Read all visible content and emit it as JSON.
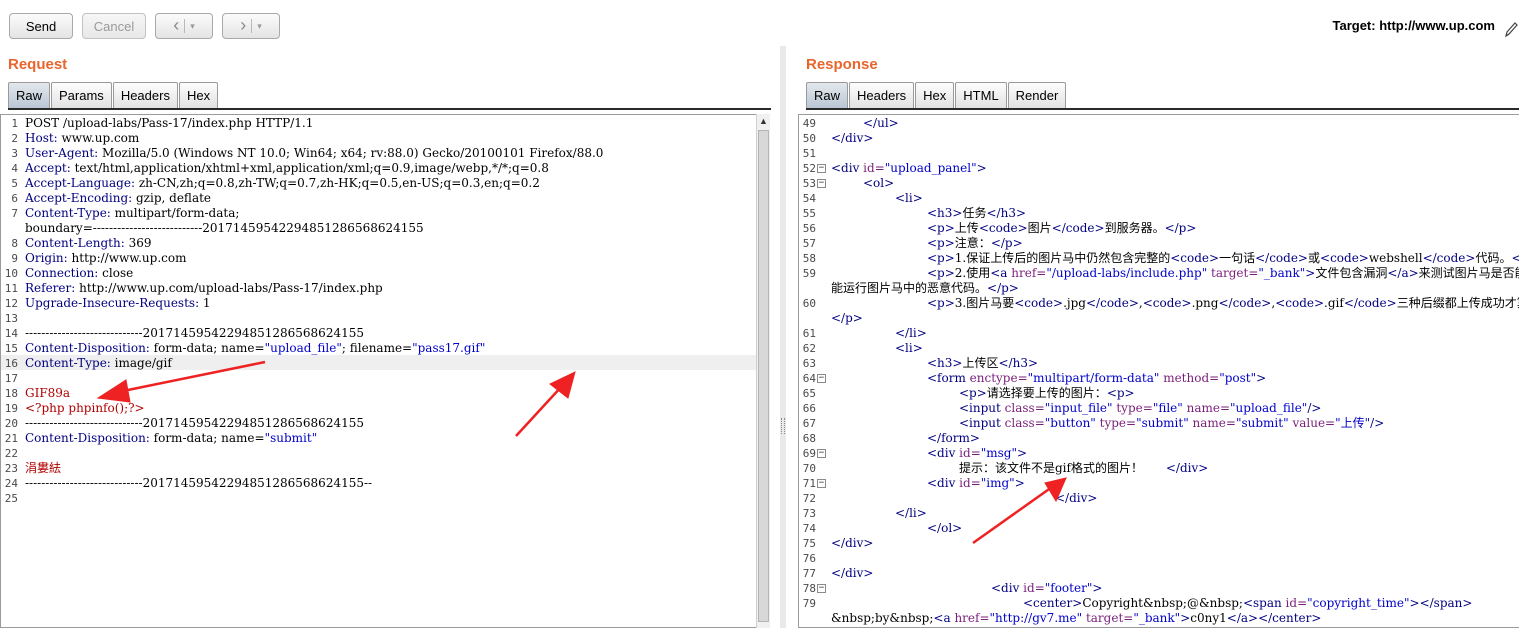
{
  "toolbar": {
    "send_label": "Send",
    "cancel_label": "Cancel",
    "back_icon": "‹",
    "forward_icon": "›",
    "dropdown_icon": "▾",
    "target_text": "Target: http://www.up.com",
    "edit_icon": "pencil-icon"
  },
  "request": {
    "title": "Request",
    "tabs": [
      "Raw",
      "Params",
      "Headers",
      "Hex"
    ],
    "active_tab": "Raw"
  },
  "response": {
    "title": "Response",
    "tabs": [
      "Raw",
      "Headers",
      "Hex",
      "HTML",
      "Render"
    ],
    "active_tab": "Raw"
  },
  "colors": {
    "title": "#e8662e",
    "header_key": "#000080",
    "string": "#0000c8",
    "annotation_arrow": "#ee2222"
  },
  "request_lines": [
    {
      "n": "1",
      "parts": [
        {
          "c": "v",
          "t": "POST /upload-labs/Pass-17/index.php HTTP/1.1"
        }
      ]
    },
    {
      "n": "2",
      "parts": [
        {
          "c": "k",
          "t": "Host: "
        },
        {
          "c": "v",
          "t": "www.up.com"
        }
      ]
    },
    {
      "n": "3",
      "parts": [
        {
          "c": "k",
          "t": "User-Agent: "
        },
        {
          "c": "v",
          "t": "Mozilla/5.0 (Windows NT 10.0; Win64; x64; rv:88.0) Gecko/20100101 Firefox/88.0"
        }
      ]
    },
    {
      "n": "4",
      "parts": [
        {
          "c": "k",
          "t": "Accept: "
        },
        {
          "c": "v",
          "t": "text/html,application/xhtml+xml,application/xml;q=0.9,image/webp,*/*;q=0.8"
        }
      ]
    },
    {
      "n": "5",
      "parts": [
        {
          "c": "k",
          "t": "Accept-Language: "
        },
        {
          "c": "v",
          "t": "zh-CN,zh;q=0.8,zh-TW;q=0.7,zh-HK;q=0.5,en-US;q=0.3,en;q=0.2"
        }
      ]
    },
    {
      "n": "6",
      "parts": [
        {
          "c": "k",
          "t": "Accept-Encoding: "
        },
        {
          "c": "v",
          "t": "gzip, deflate"
        }
      ]
    },
    {
      "n": "7",
      "parts": [
        {
          "c": "k",
          "t": "Content-Type: "
        },
        {
          "c": "v",
          "t": "multipart/form-data;"
        }
      ]
    },
    {
      "n": "",
      "parts": [
        {
          "c": "v",
          "t": "boundary=---------------------------201714595422948512865686241​55"
        }
      ]
    },
    {
      "n": "8",
      "parts": [
        {
          "c": "k",
          "t": "Content-Length: "
        },
        {
          "c": "v",
          "t": "369"
        }
      ]
    },
    {
      "n": "9",
      "parts": [
        {
          "c": "k",
          "t": "Origin: "
        },
        {
          "c": "v",
          "t": "http://www.up.com"
        }
      ]
    },
    {
      "n": "10",
      "parts": [
        {
          "c": "k",
          "t": "Connection: "
        },
        {
          "c": "v",
          "t": "close"
        }
      ]
    },
    {
      "n": "11",
      "parts": [
        {
          "c": "k",
          "t": "Referer: "
        },
        {
          "c": "v",
          "t": "http://www.up.com/upload-labs/Pass-17/index.php"
        }
      ]
    },
    {
      "n": "12",
      "parts": [
        {
          "c": "k",
          "t": "Upgrade-Insecure-Requests: "
        },
        {
          "c": "v",
          "t": "1"
        }
      ]
    },
    {
      "n": "13",
      "parts": []
    },
    {
      "n": "14",
      "parts": [
        {
          "c": "v",
          "t": "-----------------------------20171459542294851286568624155"
        }
      ]
    },
    {
      "n": "15",
      "parts": [
        {
          "c": "k",
          "t": "Content-Disposition: "
        },
        {
          "c": "v",
          "t": "form-data; name="
        },
        {
          "c": "str",
          "t": "\"upload_file\""
        },
        {
          "c": "v",
          "t": "; filename="
        },
        {
          "c": "str",
          "t": "\"pass17.gif\""
        }
      ]
    },
    {
      "n": "16",
      "parts": [
        {
          "c": "k",
          "t": "Content-Type: "
        },
        {
          "c": "v",
          "t": "image/gif"
        }
      ]
    },
    {
      "n": "17",
      "parts": []
    },
    {
      "n": "18",
      "parts": [
        {
          "c": "r",
          "t": "GIF89a"
        }
      ]
    },
    {
      "n": "19",
      "parts": [
        {
          "c": "r",
          "t": "<?php phpinfo();?>"
        }
      ]
    },
    {
      "n": "20",
      "parts": [
        {
          "c": "v",
          "t": "-----------------------------20171459542294851286568624155"
        }
      ]
    },
    {
      "n": "21",
      "parts": [
        {
          "c": "k",
          "t": "Content-Disposition: "
        },
        {
          "c": "v",
          "t": "form-data; name="
        },
        {
          "c": "str",
          "t": "\"submit\""
        }
      ]
    },
    {
      "n": "22",
      "parts": []
    },
    {
      "n": "23",
      "parts": [
        {
          "c": "r",
          "t": "涓婁紶"
        }
      ]
    },
    {
      "n": "24",
      "parts": [
        {
          "c": "v",
          "t": "-----------------------------20171459542294851286568624155--"
        }
      ]
    },
    {
      "n": "25",
      "parts": []
    }
  ],
  "response_lines": [
    {
      "n": "49",
      "f": "",
      "ind": 1,
      "parts": [
        {
          "c": "tag",
          "t": "</ul>"
        }
      ]
    },
    {
      "n": "50",
      "f": "",
      "ind": 0,
      "parts": [
        {
          "c": "tag",
          "t": "</div>"
        }
      ]
    },
    {
      "n": "51",
      "f": "",
      "ind": 0,
      "parts": []
    },
    {
      "n": "52",
      "f": "−",
      "ind": 0,
      "parts": [
        {
          "c": "tag",
          "t": "<div "
        },
        {
          "c": "attr",
          "t": "id="
        },
        {
          "c": "str",
          "t": "\"upload_panel\""
        },
        {
          "c": "tag",
          "t": ">"
        }
      ]
    },
    {
      "n": "53",
      "f": "−",
      "ind": 1,
      "parts": [
        {
          "c": "tag",
          "t": "<ol>"
        }
      ]
    },
    {
      "n": "54",
      "f": "",
      "ind": 2,
      "parts": [
        {
          "c": "tag",
          "t": "<li>"
        }
      ]
    },
    {
      "n": "55",
      "f": "",
      "ind": 3,
      "parts": [
        {
          "c": "tag",
          "t": "<h3>"
        },
        {
          "c": "tx",
          "t": "任务"
        },
        {
          "c": "tag",
          "t": "</h3>"
        }
      ]
    },
    {
      "n": "56",
      "f": "",
      "ind": 3,
      "parts": [
        {
          "c": "tag",
          "t": "<p>"
        },
        {
          "c": "tx",
          "t": "上传"
        },
        {
          "c": "tag",
          "t": "<code>"
        },
        {
          "c": "tx",
          "t": "图片"
        },
        {
          "c": "tag",
          "t": "</code>"
        },
        {
          "c": "tx",
          "t": "到服务器。"
        },
        {
          "c": "tag",
          "t": "</p>"
        }
      ]
    },
    {
      "n": "57",
      "f": "",
      "ind": 3,
      "parts": [
        {
          "c": "tag",
          "t": "<p>"
        },
        {
          "c": "tx",
          "t": "注意："
        },
        {
          "c": "tag",
          "t": "</p>"
        }
      ]
    },
    {
      "n": "58",
      "f": "",
      "ind": 3,
      "parts": [
        {
          "c": "tag",
          "t": "<p>"
        },
        {
          "c": "tx",
          "t": "1.保证上传后的图片马中仍然包含完整的"
        },
        {
          "c": "tag",
          "t": "<code>"
        },
        {
          "c": "tx",
          "t": "一句话"
        },
        {
          "c": "tag",
          "t": "</code>"
        },
        {
          "c": "tx",
          "t": "或"
        },
        {
          "c": "tag",
          "t": "<code>"
        },
        {
          "c": "tx",
          "t": "webshell"
        },
        {
          "c": "tag",
          "t": "</code>"
        },
        {
          "c": "tx",
          "t": "代码。"
        },
        {
          "c": "tag",
          "t": "</p>"
        }
      ]
    },
    {
      "n": "59",
      "f": "",
      "ind": 3,
      "parts": [
        {
          "c": "tag",
          "t": "<p>"
        },
        {
          "c": "tx",
          "t": "2.使用"
        },
        {
          "c": "tag",
          "t": "<a "
        },
        {
          "c": "attr",
          "t": "href="
        },
        {
          "c": "str",
          "t": "\"/upload-labs/include.php\""
        },
        {
          "c": "attr",
          "t": " target="
        },
        {
          "c": "str",
          "t": "\"_bank\""
        },
        {
          "c": "tag",
          "t": ">"
        },
        {
          "c": "tx",
          "t": "文件包含漏洞"
        },
        {
          "c": "tag",
          "t": "</a>"
        },
        {
          "c": "tx",
          "t": "来测试图片马是否能"
        }
      ]
    },
    {
      "n": "",
      "f": "",
      "ind": 0,
      "parts": [
        {
          "c": "tx",
          "t": "能运行图片马中的恶意代码。"
        },
        {
          "c": "tag",
          "t": "</p>"
        }
      ]
    },
    {
      "n": "60",
      "f": "",
      "ind": 3,
      "parts": [
        {
          "c": "tag",
          "t": "<p>"
        },
        {
          "c": "tx",
          "t": "3.图片马要"
        },
        {
          "c": "tag",
          "t": "<code>"
        },
        {
          "c": "tx",
          "t": ".jpg"
        },
        {
          "c": "tag",
          "t": "</code>"
        },
        {
          "c": "tx",
          "t": ","
        },
        {
          "c": "tag",
          "t": "<code>"
        },
        {
          "c": "tx",
          "t": ".png"
        },
        {
          "c": "tag",
          "t": "</code>"
        },
        {
          "c": "tx",
          "t": ","
        },
        {
          "c": "tag",
          "t": "<code>"
        },
        {
          "c": "tx",
          "t": ".gif"
        },
        {
          "c": "tag",
          "t": "</code>"
        },
        {
          "c": "tx",
          "t": "三种后缀都上传成功才算过关！"
        }
      ]
    },
    {
      "n": "",
      "f": "",
      "ind": 0,
      "parts": [
        {
          "c": "tag",
          "t": "</p>"
        }
      ]
    },
    {
      "n": "61",
      "f": "",
      "ind": 2,
      "parts": [
        {
          "c": "tag",
          "t": "</li>"
        }
      ]
    },
    {
      "n": "62",
      "f": "",
      "ind": 2,
      "parts": [
        {
          "c": "tag",
          "t": "<li>"
        }
      ]
    },
    {
      "n": "63",
      "f": "",
      "ind": 3,
      "parts": [
        {
          "c": "tag",
          "t": "<h3>"
        },
        {
          "c": "tx",
          "t": "上传区"
        },
        {
          "c": "tag",
          "t": "</h3>"
        }
      ]
    },
    {
      "n": "64",
      "f": "−",
      "ind": 3,
      "parts": [
        {
          "c": "tag",
          "t": "<form "
        },
        {
          "c": "attr",
          "t": "enctype="
        },
        {
          "c": "str",
          "t": "\"multipart/form-data\""
        },
        {
          "c": "attr",
          "t": " method="
        },
        {
          "c": "str",
          "t": "\"post\""
        },
        {
          "c": "tag",
          "t": ">"
        }
      ]
    },
    {
      "n": "65",
      "f": "",
      "ind": 4,
      "parts": [
        {
          "c": "tag",
          "t": "<p>"
        },
        {
          "c": "tx",
          "t": "请选择要上传的图片："
        },
        {
          "c": "tag",
          "t": "<p>"
        }
      ]
    },
    {
      "n": "66",
      "f": "",
      "ind": 4,
      "parts": [
        {
          "c": "tag",
          "t": "<input "
        },
        {
          "c": "attr",
          "t": "class="
        },
        {
          "c": "str",
          "t": "\"input_file\""
        },
        {
          "c": "attr",
          "t": " type="
        },
        {
          "c": "str",
          "t": "\"file\""
        },
        {
          "c": "attr",
          "t": " name="
        },
        {
          "c": "str",
          "t": "\"upload_file\""
        },
        {
          "c": "tag",
          "t": "/>"
        }
      ]
    },
    {
      "n": "67",
      "f": "",
      "ind": 4,
      "parts": [
        {
          "c": "tag",
          "t": "<input "
        },
        {
          "c": "attr",
          "t": "class="
        },
        {
          "c": "str",
          "t": "\"button\""
        },
        {
          "c": "attr",
          "t": " type="
        },
        {
          "c": "str",
          "t": "\"submit\""
        },
        {
          "c": "attr",
          "t": " name="
        },
        {
          "c": "str",
          "t": "\"submit\""
        },
        {
          "c": "attr",
          "t": " value="
        },
        {
          "c": "str",
          "t": "\"上传\""
        },
        {
          "c": "tag",
          "t": "/>"
        }
      ]
    },
    {
      "n": "68",
      "f": "",
      "ind": 3,
      "parts": [
        {
          "c": "tag",
          "t": "</form>"
        }
      ]
    },
    {
      "n": "69",
      "f": "−",
      "ind": 3,
      "parts": [
        {
          "c": "tag",
          "t": "<div "
        },
        {
          "c": "attr",
          "t": "id="
        },
        {
          "c": "str",
          "t": "\"msg\""
        },
        {
          "c": "tag",
          "t": ">"
        }
      ]
    },
    {
      "n": "70",
      "f": "",
      "ind": 4,
      "parts": [
        {
          "c": "tx",
          "t": "提示：该文件不是gif格式的图片！      "
        },
        {
          "c": "tag",
          "t": "</div>"
        }
      ]
    },
    {
      "n": "71",
      "f": "−",
      "ind": 3,
      "parts": [
        {
          "c": "tag",
          "t": "<div "
        },
        {
          "c": "attr",
          "t": "id="
        },
        {
          "c": "str",
          "t": "\"img\""
        },
        {
          "c": "tag",
          "t": ">"
        }
      ]
    },
    {
      "n": "72",
      "f": "",
      "ind": 7,
      "parts": [
        {
          "c": "tag",
          "t": "</div>"
        }
      ]
    },
    {
      "n": "73",
      "f": "",
      "ind": 2,
      "parts": [
        {
          "c": "tag",
          "t": "</li>"
        }
      ]
    },
    {
      "n": "74",
      "f": "",
      "ind": 3,
      "parts": [
        {
          "c": "tag",
          "t": "</ol>"
        }
      ]
    },
    {
      "n": "75",
      "f": "",
      "ind": 0,
      "parts": [
        {
          "c": "tag",
          "t": "</div>"
        }
      ]
    },
    {
      "n": "76",
      "f": "",
      "ind": 0,
      "parts": []
    },
    {
      "n": "77",
      "f": "",
      "ind": 0,
      "parts": [
        {
          "c": "tag",
          "t": "</div>"
        }
      ]
    },
    {
      "n": "78",
      "f": "−",
      "ind": 5,
      "parts": [
        {
          "c": "tag",
          "t": "<div "
        },
        {
          "c": "attr",
          "t": "id="
        },
        {
          "c": "str",
          "t": "\"footer\""
        },
        {
          "c": "tag",
          "t": ">"
        }
      ]
    },
    {
      "n": "79",
      "f": "",
      "ind": 6,
      "parts": [
        {
          "c": "tag",
          "t": "<center>"
        },
        {
          "c": "tx",
          "t": "Copyright&nbsp;@&nbsp;"
        },
        {
          "c": "tag",
          "t": "<span "
        },
        {
          "c": "attr",
          "t": "id="
        },
        {
          "c": "str",
          "t": "\"copyright_time\""
        },
        {
          "c": "tag",
          "t": "></span>"
        }
      ]
    },
    {
      "n": "",
      "f": "",
      "ind": 0,
      "parts": [
        {
          "c": "tx",
          "t": "&nbsp;by&nbsp;"
        },
        {
          "c": "tag",
          "t": "<a "
        },
        {
          "c": "attr",
          "t": "href="
        },
        {
          "c": "str",
          "t": "\"http://gv7.me\""
        },
        {
          "c": "attr",
          "t": " target="
        },
        {
          "c": "str",
          "t": "\"_bank\""
        },
        {
          "c": "tag",
          "t": ">"
        },
        {
          "c": "tx",
          "t": "c0ny1"
        },
        {
          "c": "tag",
          "t": "</a></center>"
        }
      ]
    }
  ]
}
